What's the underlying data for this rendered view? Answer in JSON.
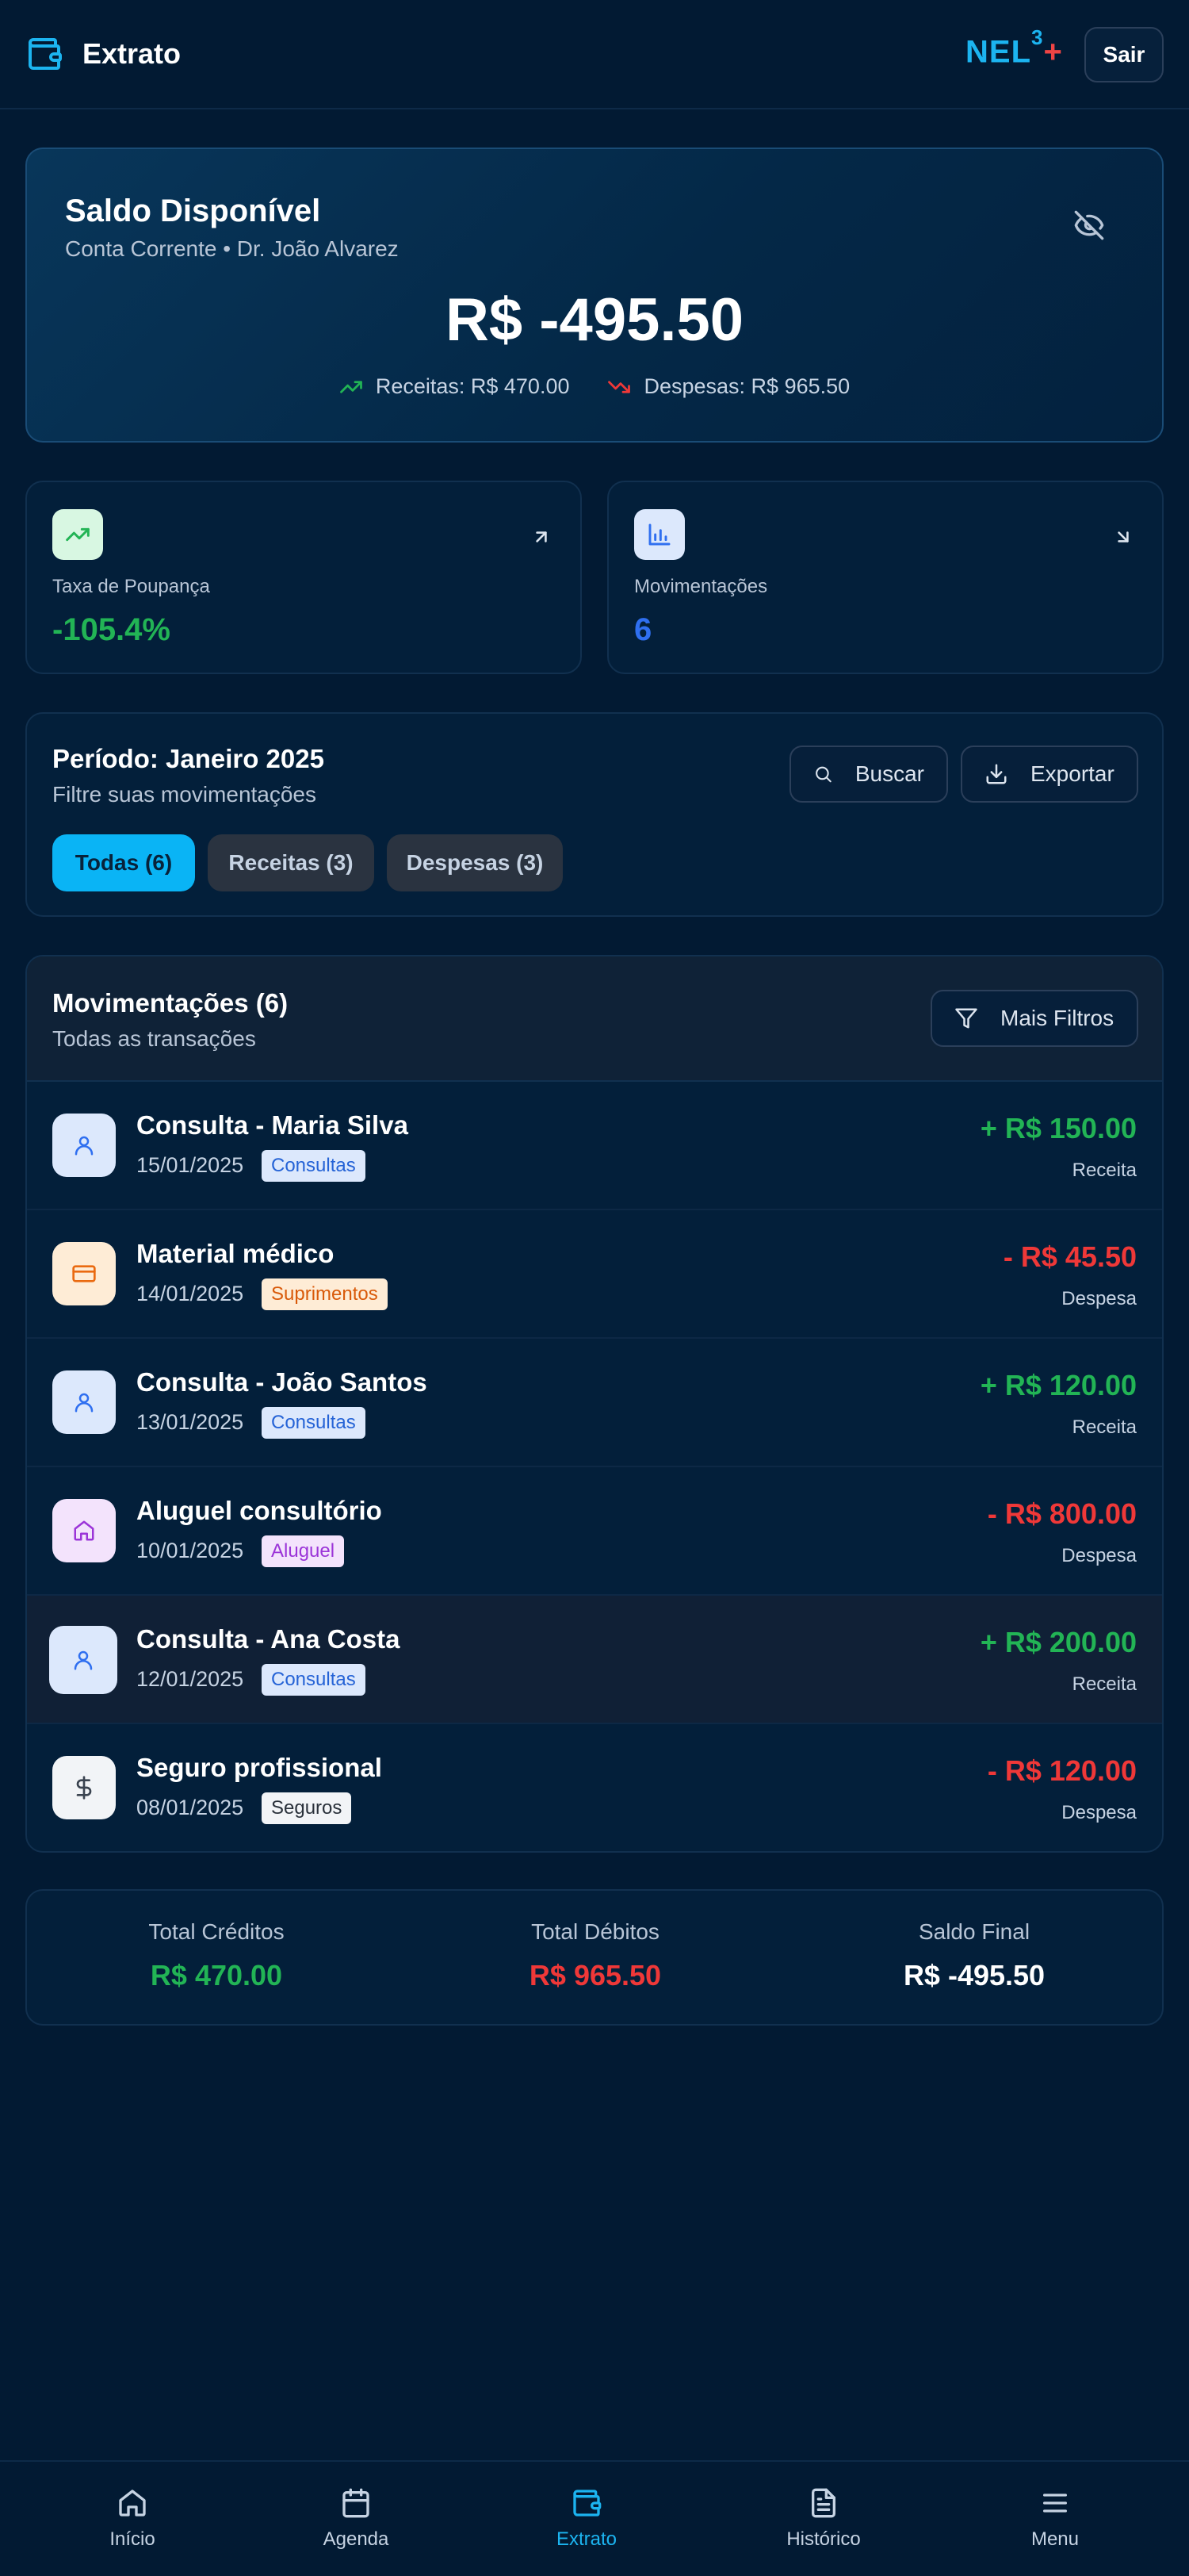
{
  "header": {
    "title": "Extrato",
    "logo_text": "NEL",
    "logo_sup": "3",
    "logo_plus": "+",
    "logout_label": "Sair"
  },
  "balance": {
    "title": "Saldo Disponível",
    "subtitle": "Conta Corrente • Dr. João Alvarez",
    "amount": "R$ -495.50",
    "income_text": "Receitas: R$ 470.00",
    "expense_text": "Despesas: R$ 965.50"
  },
  "stats": [
    {
      "label": "Taxa de Poupança",
      "value": "-105.4%",
      "icon": "trending-up-icon",
      "color": "#22b455"
    },
    {
      "label": "Movimentações",
      "value": "6",
      "icon": "bar-chart-icon",
      "color": "#2f6ff0"
    }
  ],
  "period": {
    "title": "Período: Janeiro 2025",
    "subtitle": "Filtre suas movimentações",
    "search_label": "Buscar",
    "export_label": "Exportar",
    "filters": [
      {
        "label": "Todas (6)",
        "active": true
      },
      {
        "label": "Receitas (3)",
        "active": false
      },
      {
        "label": "Despesas (3)",
        "active": false
      }
    ]
  },
  "movements": {
    "title": "Movimentações (6)",
    "subtitle": "Todas as transações",
    "more_filters_label": "Mais Filtros",
    "items": [
      {
        "name": "Consulta - Maria Silva",
        "date": "15/01/2025",
        "category": "Consultas",
        "amount": "+ R$ 150.00",
        "type": "Receita",
        "icon": "user-icon"
      },
      {
        "name": "Material médico",
        "date": "14/01/2025",
        "category": "Suprimentos",
        "amount": "- R$ 45.50",
        "type": "Despesa",
        "icon": "credit-card-icon"
      },
      {
        "name": "Consulta - João Santos",
        "date": "13/01/2025",
        "category": "Consultas",
        "amount": "+ R$ 120.00",
        "type": "Receita",
        "icon": "user-icon"
      },
      {
        "name": "Aluguel consultório",
        "date": "10/01/2025",
        "category": "Aluguel",
        "amount": "- R$ 800.00",
        "type": "Despesa",
        "icon": "home-icon"
      },
      {
        "name": "Consulta - Ana Costa",
        "date": "12/01/2025",
        "category": "Consultas",
        "amount": "+ R$ 200.00",
        "type": "Receita",
        "icon": "user-icon"
      },
      {
        "name": "Seguro profissional",
        "date": "08/01/2025",
        "category": "Seguros",
        "amount": "- R$ 120.00",
        "type": "Despesa",
        "icon": "dollar-icon"
      }
    ]
  },
  "totals": [
    {
      "label": "Total Créditos",
      "value": "R$ 470.00",
      "color": "#22b455"
    },
    {
      "label": "Total Débitos",
      "value": "R$ 965.50",
      "color": "#ef3838"
    },
    {
      "label": "Saldo Final",
      "value": "R$ -495.50",
      "color": "#ffffff"
    }
  ],
  "nav": [
    {
      "label": "Início",
      "icon": "home-icon",
      "active": false
    },
    {
      "label": "Agenda",
      "icon": "calendar-icon",
      "active": false
    },
    {
      "label": "Extrato",
      "icon": "wallet-icon",
      "active": true
    },
    {
      "label": "Histórico",
      "icon": "file-text-icon",
      "active": false
    },
    {
      "label": "Menu",
      "icon": "menu-icon",
      "active": false
    }
  ],
  "colors": {
    "accent": "#1cb4f0",
    "income": "#22b455",
    "expense": "#ef3838",
    "background": "#021a33"
  }
}
